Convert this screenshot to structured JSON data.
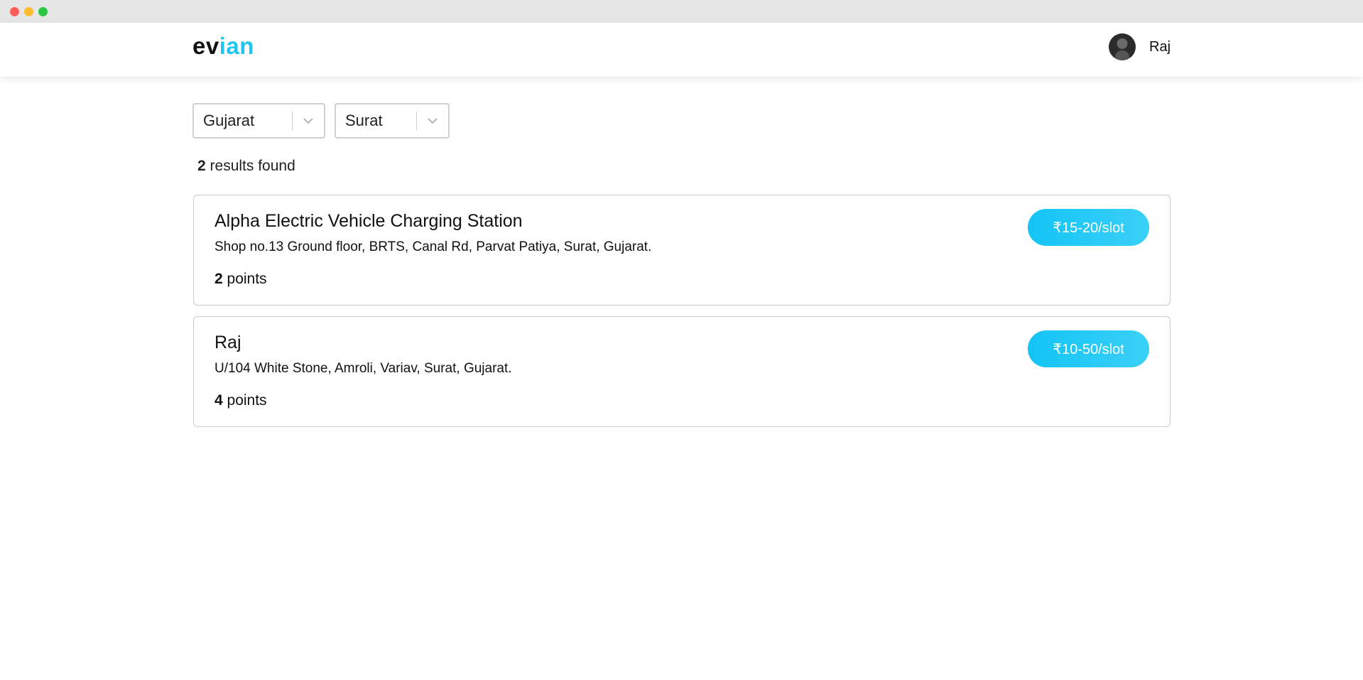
{
  "window": {
    "controls": [
      "close",
      "minimize",
      "maximize"
    ]
  },
  "header": {
    "logo_part1": "ev",
    "logo_part2": "ian",
    "user_name": "Raj"
  },
  "filters": {
    "state": "Gujarat",
    "city": "Surat"
  },
  "results": {
    "count": "2",
    "label": " results found"
  },
  "stations": [
    {
      "name": "Alpha Electric Vehicle Charging Station",
      "address": "Shop no.13 Ground floor, BRTS, Canal Rd, Parvat Patiya, Surat, Gujarat.",
      "points_count": "2",
      "points_label": " points",
      "price": "₹15-20/slot"
    },
    {
      "name": "Raj",
      "address": "U/104 White Stone, Amroli, Variav, Surat, Gujarat.",
      "points_count": "4",
      "points_label": " points",
      "price": "₹10-50/slot"
    }
  ],
  "colors": {
    "brand_accent": "#1ec6f0",
    "price_button": "#13c4f5"
  }
}
